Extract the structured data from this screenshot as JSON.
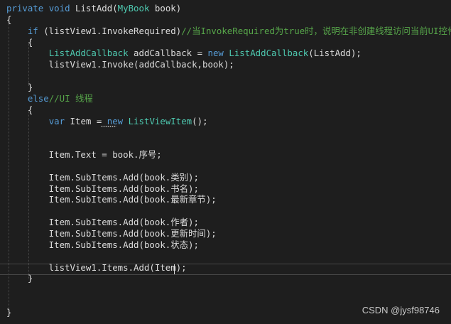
{
  "editor": {
    "lines": [
      {
        "tokens": [
          {
            "t": "kw",
            "v": "private"
          },
          {
            "t": "pl",
            "v": " "
          },
          {
            "t": "kw",
            "v": "void"
          },
          {
            "t": "pl",
            "v": " ListAdd("
          },
          {
            "t": "ty",
            "v": "MyBook"
          },
          {
            "t": "pl",
            "v": " book)"
          }
        ]
      },
      {
        "tokens": [
          {
            "t": "pl",
            "v": "{"
          }
        ]
      },
      {
        "tokens": [
          {
            "t": "pl",
            "v": "    "
          },
          {
            "t": "kw",
            "v": "if"
          },
          {
            "t": "pl",
            "v": " (listView1.InvokeRequired)"
          },
          {
            "t": "cm",
            "v": "//当InvokeRequired为true时，说明在非创建线程访问当前UI控件"
          }
        ]
      },
      {
        "tokens": [
          {
            "t": "pl",
            "v": "    {"
          }
        ]
      },
      {
        "tokens": [
          {
            "t": "pl",
            "v": "        "
          },
          {
            "t": "ty",
            "v": "ListAddCallback"
          },
          {
            "t": "pl",
            "v": " addCallback = "
          },
          {
            "t": "kw",
            "v": "new"
          },
          {
            "t": "pl",
            "v": " "
          },
          {
            "t": "ty",
            "v": "ListAddCallback"
          },
          {
            "t": "pl",
            "v": "(ListAdd);"
          }
        ]
      },
      {
        "tokens": [
          {
            "t": "pl",
            "v": "        listView1.Invoke(addCallback,book);"
          }
        ]
      },
      {
        "tokens": []
      },
      {
        "tokens": [
          {
            "t": "pl",
            "v": "    }"
          }
        ]
      },
      {
        "tokens": [
          {
            "t": "pl",
            "v": "    "
          },
          {
            "t": "kw",
            "v": "else"
          },
          {
            "t": "cm",
            "v": "//UI 线程"
          }
        ]
      },
      {
        "tokens": [
          {
            "t": "pl",
            "v": "    {"
          }
        ]
      },
      {
        "tokens": [
          {
            "t": "pl",
            "v": "        "
          },
          {
            "t": "kw",
            "v": "var"
          },
          {
            "t": "pl",
            "v": " Item = "
          },
          {
            "t": "kw",
            "v": "new"
          },
          {
            "t": "pl",
            "v": " "
          },
          {
            "t": "ty",
            "v": "ListViewItem"
          },
          {
            "t": "pl",
            "v": "();"
          }
        ]
      },
      {
        "tokens": []
      },
      {
        "tokens": []
      },
      {
        "tokens": [
          {
            "t": "pl",
            "v": "        Item.Text = book.序号;"
          }
        ]
      },
      {
        "tokens": []
      },
      {
        "tokens": [
          {
            "t": "pl",
            "v": "        Item.SubItems.Add(book.类别);"
          }
        ]
      },
      {
        "tokens": [
          {
            "t": "pl",
            "v": "        Item.SubItems.Add(book.书名);"
          }
        ]
      },
      {
        "tokens": [
          {
            "t": "pl",
            "v": "        Item.SubItems.Add(book.最新章节);"
          }
        ]
      },
      {
        "tokens": []
      },
      {
        "tokens": [
          {
            "t": "pl",
            "v": "        Item.SubItems.Add(book.作者);"
          }
        ]
      },
      {
        "tokens": [
          {
            "t": "pl",
            "v": "        Item.SubItems.Add(book.更新时间);"
          }
        ]
      },
      {
        "tokens": [
          {
            "t": "pl",
            "v": "        Item.SubItems.Add(book.状态);"
          }
        ]
      },
      {
        "tokens": []
      },
      {
        "tokens": [
          {
            "t": "pl",
            "v": "        listView1.Items.Add(Item);"
          }
        ]
      },
      {
        "tokens": [
          {
            "t": "pl",
            "v": "    }"
          }
        ]
      },
      {
        "tokens": []
      },
      {
        "tokens": []
      },
      {
        "tokens": [
          {
            "t": "pl",
            "v": "}"
          }
        ]
      }
    ],
    "current_line": 23
  },
  "watermark": "CSDN @jysf98746"
}
